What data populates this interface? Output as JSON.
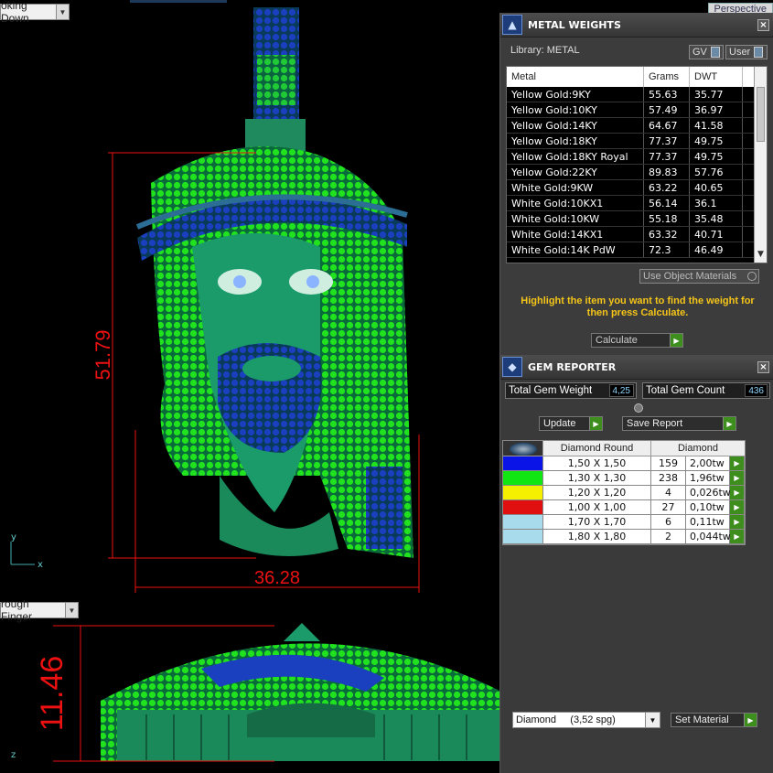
{
  "viewports": {
    "top_label": "oking Down",
    "bottom_label": "rough Finger",
    "right_label": "Perspective",
    "top_dims": {
      "height": "51.79",
      "width": "36.28"
    },
    "bottom_dims": {
      "height": "11.46"
    },
    "axis_y": "y",
    "axis_x": "x",
    "axis_z": "z"
  },
  "metal_panel": {
    "title": "METAL WEIGHTS",
    "close": "×",
    "library": "Library: METAL",
    "gv_label": "GV",
    "user_label": "User",
    "columns": [
      "Metal",
      "Grams",
      "DWT"
    ],
    "rows": [
      [
        "Yellow Gold:9KY",
        "55.63",
        "35.77"
      ],
      [
        "Yellow Gold:10KY",
        "57.49",
        "36.97"
      ],
      [
        "Yellow Gold:14KY",
        "64.67",
        "41.58"
      ],
      [
        "Yellow Gold:18KY",
        "77.37",
        "49.75"
      ],
      [
        "Yellow Gold:18KY Royal",
        "77.37",
        "49.75"
      ],
      [
        "Yellow Gold:22KY",
        "89.83",
        "57.76"
      ],
      [
        "White Gold:9KW",
        "63.22",
        "40.65"
      ],
      [
        "White Gold:10KX1",
        "56.14",
        "36.1"
      ],
      [
        "White Gold:10KW",
        "55.18",
        "35.48"
      ],
      [
        "White Gold:14KX1",
        "63.32",
        "40.71"
      ],
      [
        "White Gold:14K PdW",
        "72.3",
        "46.49"
      ]
    ],
    "use_object_materials": "Use Object Materials",
    "hint": "Highlight the item you want to find the weight for then press Calculate.",
    "calculate": "Calculate"
  },
  "gem_panel": {
    "title": "GEM REPORTER",
    "close": "×",
    "total_weight_label": "Total Gem Weight",
    "total_weight": "4,25",
    "total_count_label": "Total Gem Count",
    "total_count": "436",
    "update": "Update",
    "save_report": "Save Report",
    "columns": [
      "Diamond Round",
      "Diamond"
    ],
    "rows": [
      {
        "color": "#0a14e6",
        "size": "1,50 X 1,50",
        "count": "159",
        "weight": "2,00tw"
      },
      {
        "color": "#12e612",
        "size": "1,30 X 1,30",
        "count": "238",
        "weight": "1,96tw"
      },
      {
        "color": "#f5f000",
        "size": "1,20 X 1,20",
        "count": "4",
        "weight": "0,026tw"
      },
      {
        "color": "#e01010",
        "size": "1,00 X 1,00",
        "count": "27",
        "weight": "0,10tw"
      },
      {
        "color": "#a8dcec",
        "size": "1,70 X 1,70",
        "count": "6",
        "weight": "0,11tw"
      },
      {
        "color": "#a8dcec",
        "size": "1,80 X 1,80",
        "count": "2",
        "weight": "0,044tw"
      }
    ],
    "material_select": "Diamond     (3,52 spg)",
    "set_material": "Set Material"
  }
}
